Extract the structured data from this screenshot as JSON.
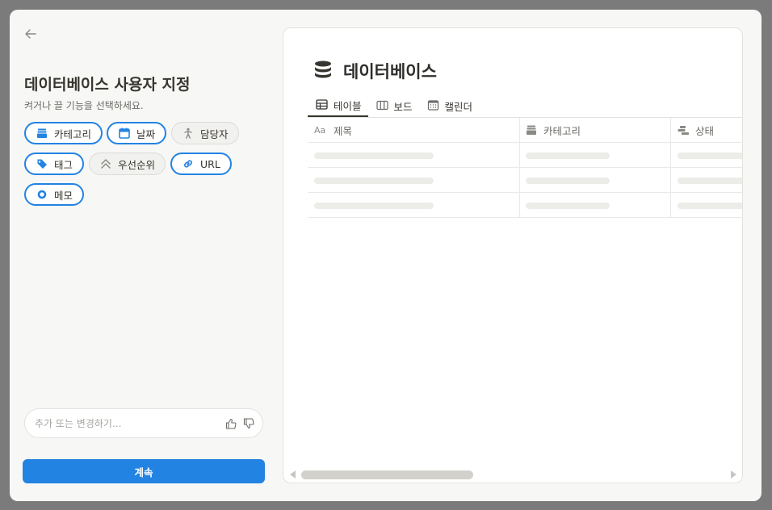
{
  "left": {
    "title": "데이터베이스 사용자 지정",
    "subtitle": "켜거나 끌 기능을 선택하세요.",
    "chips": [
      {
        "label": "카테고리",
        "icon": "stack-icon",
        "on": true
      },
      {
        "label": "날짜",
        "icon": "calendar-icon",
        "on": true
      },
      {
        "label": "담당자",
        "icon": "person-icon",
        "on": false
      },
      {
        "label": "태그",
        "icon": "tag-icon",
        "on": true
      },
      {
        "label": "우선순위",
        "icon": "double-chevron-up-icon",
        "on": false
      },
      {
        "label": "URL",
        "icon": "link-icon",
        "on": true
      },
      {
        "label": "메모",
        "icon": "circle-icon",
        "on": true
      }
    ],
    "input": {
      "placeholder": "추가 또는 변경하기...",
      "value": ""
    },
    "continue_label": "계속"
  },
  "preview": {
    "title": "데이터베이스",
    "tabs": [
      {
        "label": "테이블",
        "icon": "table-icon",
        "active": true
      },
      {
        "label": "보드",
        "icon": "board-icon",
        "active": false
      },
      {
        "label": "캘린더",
        "icon": "calendar-icon",
        "active": false
      }
    ],
    "columns": [
      {
        "label": "제목",
        "icon": "text-aa-icon"
      },
      {
        "label": "카테고리",
        "icon": "stack-icon"
      },
      {
        "label": "상태",
        "icon": "status-icon"
      }
    ],
    "column_icon_text": "Aa",
    "row_count": 3
  },
  "colors": {
    "accent": "#2383e2",
    "text": "#37352f",
    "muted": "#6b6a66",
    "panel_bg": "#f7f7f5"
  }
}
